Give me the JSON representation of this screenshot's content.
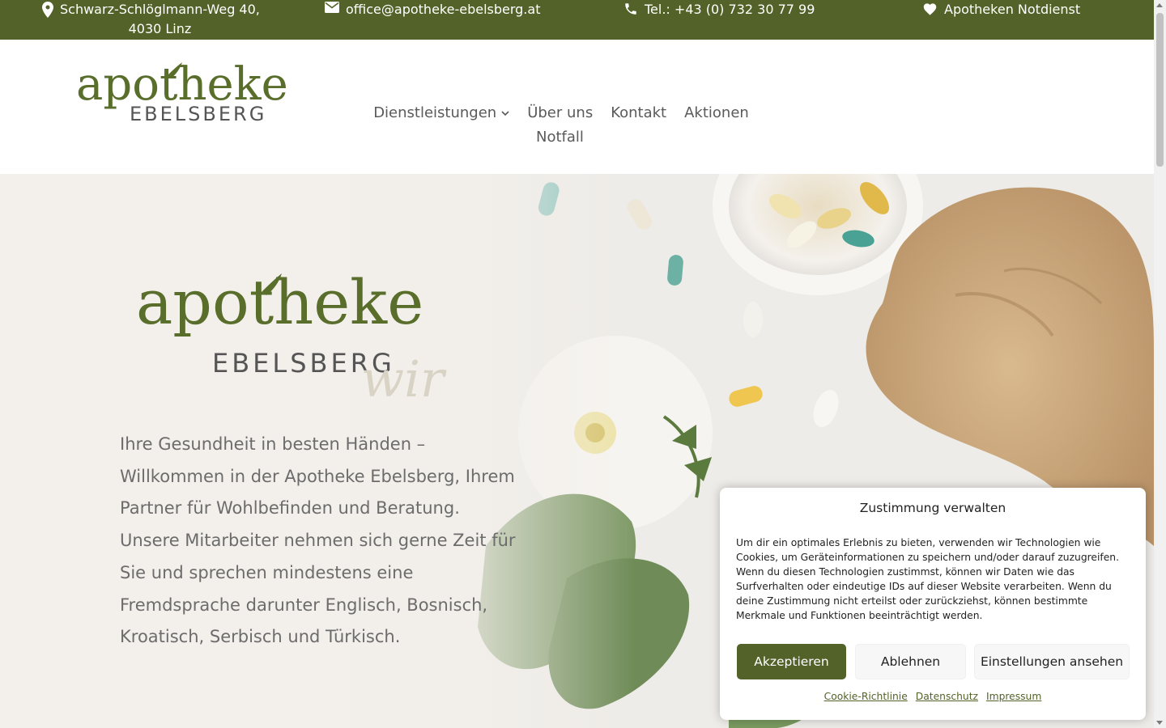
{
  "topbar": {
    "address_line1": "Schwarz-Schlöglmann-Weg 40,",
    "address_line2": "4030 Linz",
    "email": "office@apotheke-ebelsberg.at",
    "phone": "Tel.: +43 (0) 732 30 77 99",
    "emergency": "Apotheken Notdienst"
  },
  "logo": {
    "word": "apotheke",
    "sub": "EBELSBERG",
    "script": "wir"
  },
  "nav": {
    "items": [
      {
        "label": "Dienstleistungen"
      },
      {
        "label": "Über uns"
      },
      {
        "label": "Kontakt"
      },
      {
        "label": "Aktionen"
      }
    ],
    "second_row": "Notfall"
  },
  "hero": {
    "text": "Ihre Gesundheit in besten Händen – Willkommen in der Apotheke Ebelsberg, Ihrem Partner für Wohlbefinden und Beratung. Unsere Mitarbeiter nehmen sich gerne Zeit für Sie und sprechen mindestens eine Fremdsprache darunter Englisch, Bosnisch, Kroatisch, Serbisch und Türkisch."
  },
  "cookie": {
    "title": "Zustimmung verwalten",
    "body": "Um dir ein optimales Erlebnis zu bieten, verwenden wir Technologien wie Cookies, um Geräteinformationen zu speichern und/oder darauf zuzugreifen. Wenn du diesen Technologien zustimmst, können wir Daten wie das Surfverhalten oder eindeutige IDs auf dieser Website verarbeiten. Wenn du deine Zustimmung nicht erteilst oder zurückziehst, können bestimmte Merkmale und Funktionen beeinträchtigt werden.",
    "accept": "Akzeptieren",
    "deny": "Ablehnen",
    "settings": "Einstellungen ansehen",
    "links": [
      "Cookie-Richtlinie",
      "Datenschutz",
      "Impressum"
    ]
  },
  "colors": {
    "brand": "#536228",
    "text": "#6c6c6c"
  }
}
